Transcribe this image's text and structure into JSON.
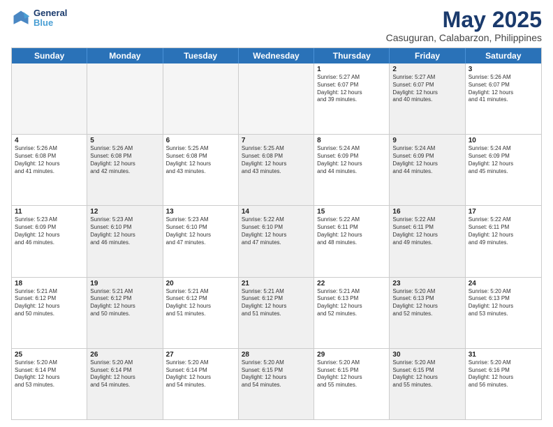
{
  "header": {
    "logo_line1": "General",
    "logo_line2": "Blue",
    "title": "May 2025",
    "subtitle": "Casuguran, Calabarzon, Philippines"
  },
  "days": [
    "Sunday",
    "Monday",
    "Tuesday",
    "Wednesday",
    "Thursday",
    "Friday",
    "Saturday"
  ],
  "rows": [
    [
      {
        "day": "",
        "lines": [],
        "empty": true
      },
      {
        "day": "",
        "lines": [],
        "empty": true
      },
      {
        "day": "",
        "lines": [],
        "empty": true
      },
      {
        "day": "",
        "lines": [],
        "empty": true
      },
      {
        "day": "1",
        "lines": [
          "Sunrise: 5:27 AM",
          "Sunset: 6:07 PM",
          "Daylight: 12 hours",
          "and 39 minutes."
        ],
        "shaded": false
      },
      {
        "day": "2",
        "lines": [
          "Sunrise: 5:27 AM",
          "Sunset: 6:07 PM",
          "Daylight: 12 hours",
          "and 40 minutes."
        ],
        "shaded": true
      },
      {
        "day": "3",
        "lines": [
          "Sunrise: 5:26 AM",
          "Sunset: 6:07 PM",
          "Daylight: 12 hours",
          "and 41 minutes."
        ],
        "shaded": false
      }
    ],
    [
      {
        "day": "4",
        "lines": [
          "Sunrise: 5:26 AM",
          "Sunset: 6:08 PM",
          "Daylight: 12 hours",
          "and 41 minutes."
        ],
        "shaded": false
      },
      {
        "day": "5",
        "lines": [
          "Sunrise: 5:26 AM",
          "Sunset: 6:08 PM",
          "Daylight: 12 hours",
          "and 42 minutes."
        ],
        "shaded": true
      },
      {
        "day": "6",
        "lines": [
          "Sunrise: 5:25 AM",
          "Sunset: 6:08 PM",
          "Daylight: 12 hours",
          "and 43 minutes."
        ],
        "shaded": false
      },
      {
        "day": "7",
        "lines": [
          "Sunrise: 5:25 AM",
          "Sunset: 6:08 PM",
          "Daylight: 12 hours",
          "and 43 minutes."
        ],
        "shaded": true
      },
      {
        "day": "8",
        "lines": [
          "Sunrise: 5:24 AM",
          "Sunset: 6:09 PM",
          "Daylight: 12 hours",
          "and 44 minutes."
        ],
        "shaded": false
      },
      {
        "day": "9",
        "lines": [
          "Sunrise: 5:24 AM",
          "Sunset: 6:09 PM",
          "Daylight: 12 hours",
          "and 44 minutes."
        ],
        "shaded": true
      },
      {
        "day": "10",
        "lines": [
          "Sunrise: 5:24 AM",
          "Sunset: 6:09 PM",
          "Daylight: 12 hours",
          "and 45 minutes."
        ],
        "shaded": false
      }
    ],
    [
      {
        "day": "11",
        "lines": [
          "Sunrise: 5:23 AM",
          "Sunset: 6:09 PM",
          "Daylight: 12 hours",
          "and 46 minutes."
        ],
        "shaded": false
      },
      {
        "day": "12",
        "lines": [
          "Sunrise: 5:23 AM",
          "Sunset: 6:10 PM",
          "Daylight: 12 hours",
          "and 46 minutes."
        ],
        "shaded": true
      },
      {
        "day": "13",
        "lines": [
          "Sunrise: 5:23 AM",
          "Sunset: 6:10 PM",
          "Daylight: 12 hours",
          "and 47 minutes."
        ],
        "shaded": false
      },
      {
        "day": "14",
        "lines": [
          "Sunrise: 5:22 AM",
          "Sunset: 6:10 PM",
          "Daylight: 12 hours",
          "and 47 minutes."
        ],
        "shaded": true
      },
      {
        "day": "15",
        "lines": [
          "Sunrise: 5:22 AM",
          "Sunset: 6:11 PM",
          "Daylight: 12 hours",
          "and 48 minutes."
        ],
        "shaded": false
      },
      {
        "day": "16",
        "lines": [
          "Sunrise: 5:22 AM",
          "Sunset: 6:11 PM",
          "Daylight: 12 hours",
          "and 49 minutes."
        ],
        "shaded": true
      },
      {
        "day": "17",
        "lines": [
          "Sunrise: 5:22 AM",
          "Sunset: 6:11 PM",
          "Daylight: 12 hours",
          "and 49 minutes."
        ],
        "shaded": false
      }
    ],
    [
      {
        "day": "18",
        "lines": [
          "Sunrise: 5:21 AM",
          "Sunset: 6:12 PM",
          "Daylight: 12 hours",
          "and 50 minutes."
        ],
        "shaded": false
      },
      {
        "day": "19",
        "lines": [
          "Sunrise: 5:21 AM",
          "Sunset: 6:12 PM",
          "Daylight: 12 hours",
          "and 50 minutes."
        ],
        "shaded": true
      },
      {
        "day": "20",
        "lines": [
          "Sunrise: 5:21 AM",
          "Sunset: 6:12 PM",
          "Daylight: 12 hours",
          "and 51 minutes."
        ],
        "shaded": false
      },
      {
        "day": "21",
        "lines": [
          "Sunrise: 5:21 AM",
          "Sunset: 6:12 PM",
          "Daylight: 12 hours",
          "and 51 minutes."
        ],
        "shaded": true
      },
      {
        "day": "22",
        "lines": [
          "Sunrise: 5:21 AM",
          "Sunset: 6:13 PM",
          "Daylight: 12 hours",
          "and 52 minutes."
        ],
        "shaded": false
      },
      {
        "day": "23",
        "lines": [
          "Sunrise: 5:20 AM",
          "Sunset: 6:13 PM",
          "Daylight: 12 hours",
          "and 52 minutes."
        ],
        "shaded": true
      },
      {
        "day": "24",
        "lines": [
          "Sunrise: 5:20 AM",
          "Sunset: 6:13 PM",
          "Daylight: 12 hours",
          "and 53 minutes."
        ],
        "shaded": false
      }
    ],
    [
      {
        "day": "25",
        "lines": [
          "Sunrise: 5:20 AM",
          "Sunset: 6:14 PM",
          "Daylight: 12 hours",
          "and 53 minutes."
        ],
        "shaded": false
      },
      {
        "day": "26",
        "lines": [
          "Sunrise: 5:20 AM",
          "Sunset: 6:14 PM",
          "Daylight: 12 hours",
          "and 54 minutes."
        ],
        "shaded": true
      },
      {
        "day": "27",
        "lines": [
          "Sunrise: 5:20 AM",
          "Sunset: 6:14 PM",
          "Daylight: 12 hours",
          "and 54 minutes."
        ],
        "shaded": false
      },
      {
        "day": "28",
        "lines": [
          "Sunrise: 5:20 AM",
          "Sunset: 6:15 PM",
          "Daylight: 12 hours",
          "and 54 minutes."
        ],
        "shaded": true
      },
      {
        "day": "29",
        "lines": [
          "Sunrise: 5:20 AM",
          "Sunset: 6:15 PM",
          "Daylight: 12 hours",
          "and 55 minutes."
        ],
        "shaded": false
      },
      {
        "day": "30",
        "lines": [
          "Sunrise: 5:20 AM",
          "Sunset: 6:15 PM",
          "Daylight: 12 hours",
          "and 55 minutes."
        ],
        "shaded": true
      },
      {
        "day": "31",
        "lines": [
          "Sunrise: 5:20 AM",
          "Sunset: 6:16 PM",
          "Daylight: 12 hours",
          "and 56 minutes."
        ],
        "shaded": false
      }
    ]
  ]
}
